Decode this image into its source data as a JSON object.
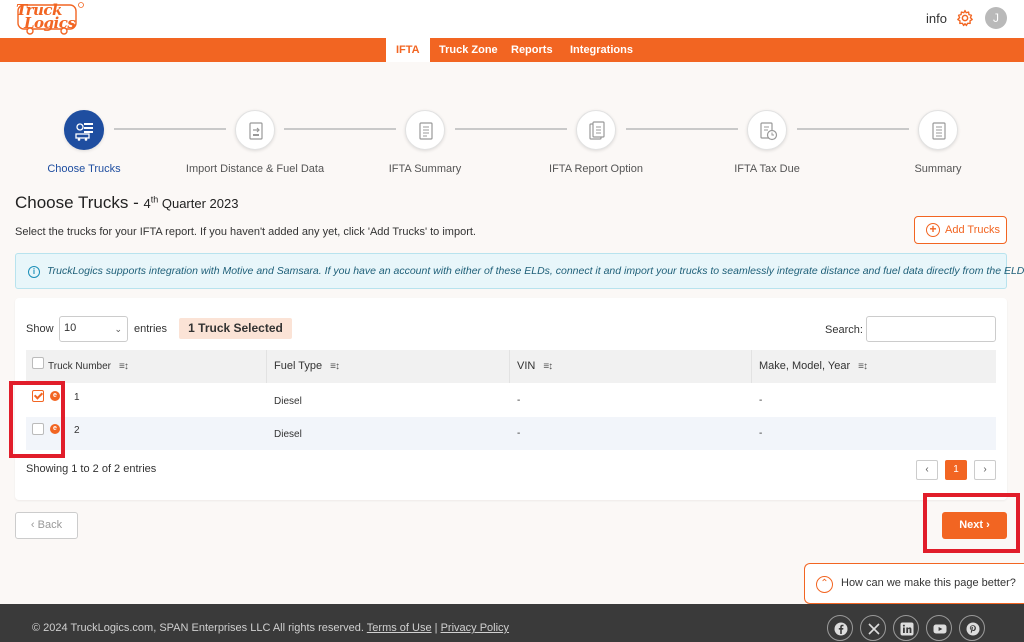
{
  "header": {
    "logo_text": "TruckLogics",
    "logo_line1": "Truck",
    "logo_line2": "Logics",
    "info_label": "info",
    "avatar_initial": "J"
  },
  "nav": {
    "items": [
      {
        "label": "IFTA",
        "active": true
      },
      {
        "label": "Truck Zone",
        "active": false
      },
      {
        "label": "Reports",
        "active": false
      },
      {
        "label": "Integrations",
        "active": false
      }
    ]
  },
  "stepper": {
    "steps": [
      {
        "label": "Choose Trucks",
        "active": true
      },
      {
        "label": "Import Distance & Fuel Data",
        "active": false
      },
      {
        "label": "IFTA Summary",
        "active": false
      },
      {
        "label": "IFTA Report Option",
        "active": false
      },
      {
        "label": "IFTA Tax Due",
        "active": false
      },
      {
        "label": "Summary",
        "active": false
      }
    ]
  },
  "page": {
    "title": "Choose Trucks - ",
    "quarter_num": "4",
    "quarter_sup": "th",
    "quarter_rest": " Quarter 2023",
    "subtitle": "Select the trucks for your IFTA report. If you haven't added any yet, click 'Add Trucks' to import.",
    "add_trucks_label": "Add Trucks",
    "alert_text": "TruckLogics supports integration with Motive and Samsara. If you have an account with either of these ELDs, connect it and import your trucks to seamlessly integrate distance and fuel data directly from the ELD."
  },
  "table": {
    "show_label": "Show",
    "entries_label": "entries",
    "page_size": "10",
    "selected_badge": "1 Truck Selected",
    "search_label": "Search:",
    "search_value": "",
    "columns": [
      "Truck Number",
      "Fuel Type",
      "VIN",
      "Make, Model, Year"
    ],
    "rows": [
      {
        "truck_number": "1",
        "fuel_type": "Diesel",
        "vin": "-",
        "make_model_year": "-",
        "checked": true
      },
      {
        "truck_number": "2",
        "fuel_type": "Diesel",
        "vin": "-",
        "make_model_year": "-",
        "checked": false
      }
    ],
    "showing_text": "Showing 1 to 2 of 2 entries",
    "pagination": {
      "prev": "‹",
      "current": "1",
      "next": "›"
    }
  },
  "actions": {
    "back_label": "‹ Back",
    "next_label": "Next ›"
  },
  "feedback": {
    "text": "How can we make this page better?"
  },
  "footer": {
    "copyright": "© 2024 TruckLogics.com, SPAN Enterprises LLC All rights reserved.",
    "terms": "Terms of Use",
    "separator": "|",
    "privacy": "Privacy Policy",
    "social_icons": [
      "facebook-icon",
      "x-icon",
      "linkedin-icon",
      "youtube-icon",
      "pinterest-icon"
    ]
  },
  "colors": {
    "brand_orange": "#f26522",
    "active_step_blue": "#1f4ea0",
    "highlight_red": "#e11d2a",
    "footer_bg": "#3a3a3a"
  }
}
